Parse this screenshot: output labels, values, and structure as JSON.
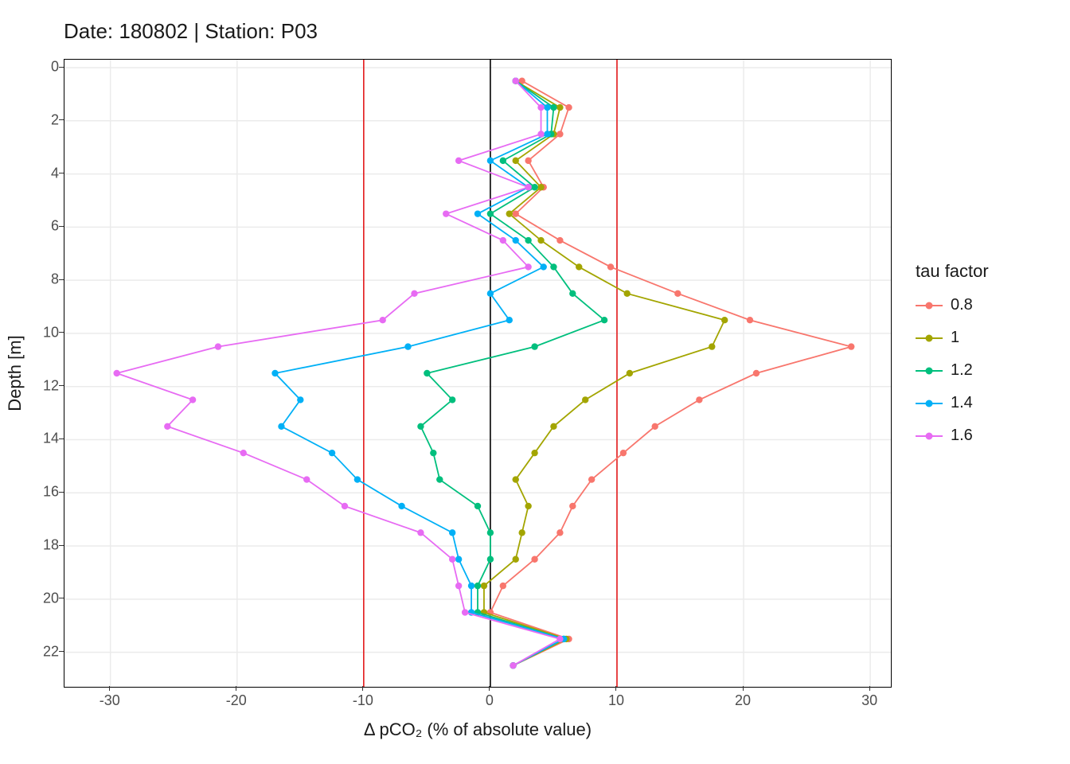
{
  "chart_data": {
    "type": "line",
    "title": "Date: 180802 | Station: P03",
    "xlabel": "Δ pCO₂ (% of absolute value)",
    "ylabel": "Depth [m]",
    "xlim": [
      -33,
      31
    ],
    "ylim": [
      0,
      23
    ],
    "y_reversed": true,
    "x_ticks": [
      -30,
      -20,
      -10,
      0,
      10,
      20,
      30
    ],
    "y_ticks": [
      0,
      2,
      4,
      6,
      8,
      10,
      12,
      14,
      16,
      18,
      20,
      22
    ],
    "vlines": [
      {
        "x": -10,
        "color": "#E41A1C"
      },
      {
        "x": 0,
        "color": "#000000"
      },
      {
        "x": 10,
        "color": "#E41A1C"
      }
    ],
    "legend_title": "tau factor",
    "series": [
      {
        "name": "0.8",
        "color": "#F8766D",
        "depth": [
          0.5,
          1.5,
          2.5,
          3.5,
          4.5,
          5.5,
          6.5,
          7.5,
          8.5,
          9.5,
          10.5,
          11.5,
          12.5,
          13.5,
          14.5,
          15.5,
          16.5,
          17.5,
          18.5,
          19.5,
          20.5,
          21.5,
          22.5
        ],
        "values": [
          2.5,
          6.2,
          5.5,
          3.0,
          4.2,
          2.0,
          5.5,
          9.5,
          14.8,
          20.5,
          28.5,
          21.0,
          16.5,
          13.0,
          10.5,
          8.0,
          6.5,
          5.5,
          3.5,
          1.0,
          0.0,
          6.2,
          1.8
        ]
      },
      {
        "name": "1",
        "color": "#A3A500",
        "depth": [
          0.5,
          1.5,
          2.5,
          3.5,
          4.5,
          5.5,
          6.5,
          7.5,
          8.5,
          9.5,
          10.5,
          11.5,
          12.5,
          13.5,
          14.5,
          15.5,
          16.5,
          17.5,
          18.5,
          19.5,
          20.5,
          21.5,
          22.5
        ],
        "values": [
          2.0,
          5.5,
          5.0,
          2.0,
          4.0,
          1.5,
          4.0,
          7.0,
          10.8,
          18.5,
          17.5,
          11.0,
          7.5,
          5.0,
          3.5,
          2.0,
          3.0,
          2.5,
          2.0,
          -0.5,
          -0.5,
          6.0,
          1.8
        ]
      },
      {
        "name": "1.2",
        "color": "#00BF7D",
        "depth": [
          0.5,
          1.5,
          2.5,
          3.5,
          4.5,
          5.5,
          6.5,
          7.5,
          8.5,
          9.5,
          10.5,
          11.5,
          12.5,
          13.5,
          14.5,
          15.5,
          16.5,
          17.5,
          18.5,
          19.5,
          20.5,
          21.5,
          22.5
        ],
        "values": [
          2.0,
          5.0,
          4.8,
          1.0,
          3.5,
          0.0,
          3.0,
          5.0,
          6.5,
          9.0,
          3.5,
          -5.0,
          -3.0,
          -5.5,
          -4.5,
          -4.0,
          -1.0,
          0.0,
          0.0,
          -1.0,
          -1.0,
          5.8,
          1.8
        ]
      },
      {
        "name": "1.4",
        "color": "#00B0F6",
        "depth": [
          0.5,
          1.5,
          2.5,
          3.5,
          4.5,
          5.5,
          6.5,
          7.5,
          8.5,
          9.5,
          10.5,
          11.5,
          12.5,
          13.5,
          14.5,
          15.5,
          16.5,
          17.5,
          18.5,
          19.5,
          20.5,
          21.5,
          22.5
        ],
        "values": [
          2.0,
          4.5,
          4.5,
          0.0,
          3.0,
          -1.0,
          2.0,
          4.2,
          0.0,
          1.5,
          -6.5,
          -17.0,
          -15.0,
          -16.5,
          -12.5,
          -10.5,
          -7.0,
          -3.0,
          -2.5,
          -1.5,
          -1.5,
          5.8,
          1.8
        ]
      },
      {
        "name": "1.6",
        "color": "#E76BF3",
        "depth": [
          0.5,
          1.5,
          2.5,
          3.5,
          4.5,
          5.5,
          6.5,
          7.5,
          8.5,
          9.5,
          10.5,
          11.5,
          12.5,
          13.5,
          14.5,
          15.5,
          16.5,
          17.5,
          18.5,
          19.5,
          20.5,
          21.5,
          22.5
        ],
        "values": [
          2.0,
          4.0,
          4.0,
          -2.5,
          3.0,
          -3.5,
          1.0,
          3.0,
          -6.0,
          -8.5,
          -21.5,
          -29.5,
          -23.5,
          -25.5,
          -19.5,
          -14.5,
          -11.5,
          -5.5,
          -3.0,
          -2.5,
          -2.0,
          5.5,
          1.8
        ]
      }
    ]
  }
}
